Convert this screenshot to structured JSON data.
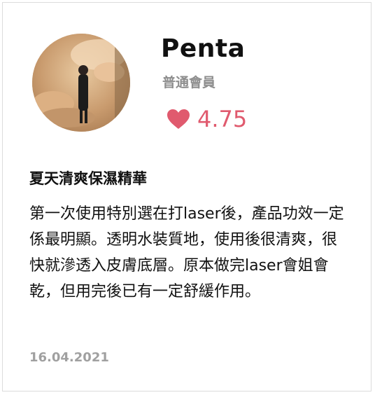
{
  "reviewer": {
    "name": "Penta",
    "member_level": "普通會員",
    "rating": "4.75"
  },
  "review": {
    "title": "夏天清爽保濕精華",
    "body": "第一次使用特別選在打laser後，產品功效一定係最明顯。透明水裝質地，使用後很清爽，很快就滲透入皮膚底層。原本做完laser會姐會乾，但用完後已有一定舒緩作用。",
    "date": "16.04.2021"
  },
  "icons": {
    "rating": "heart-icon"
  },
  "colors": {
    "accent": "#e05a6e",
    "muted": "#8e8e8e",
    "text": "#111111"
  }
}
